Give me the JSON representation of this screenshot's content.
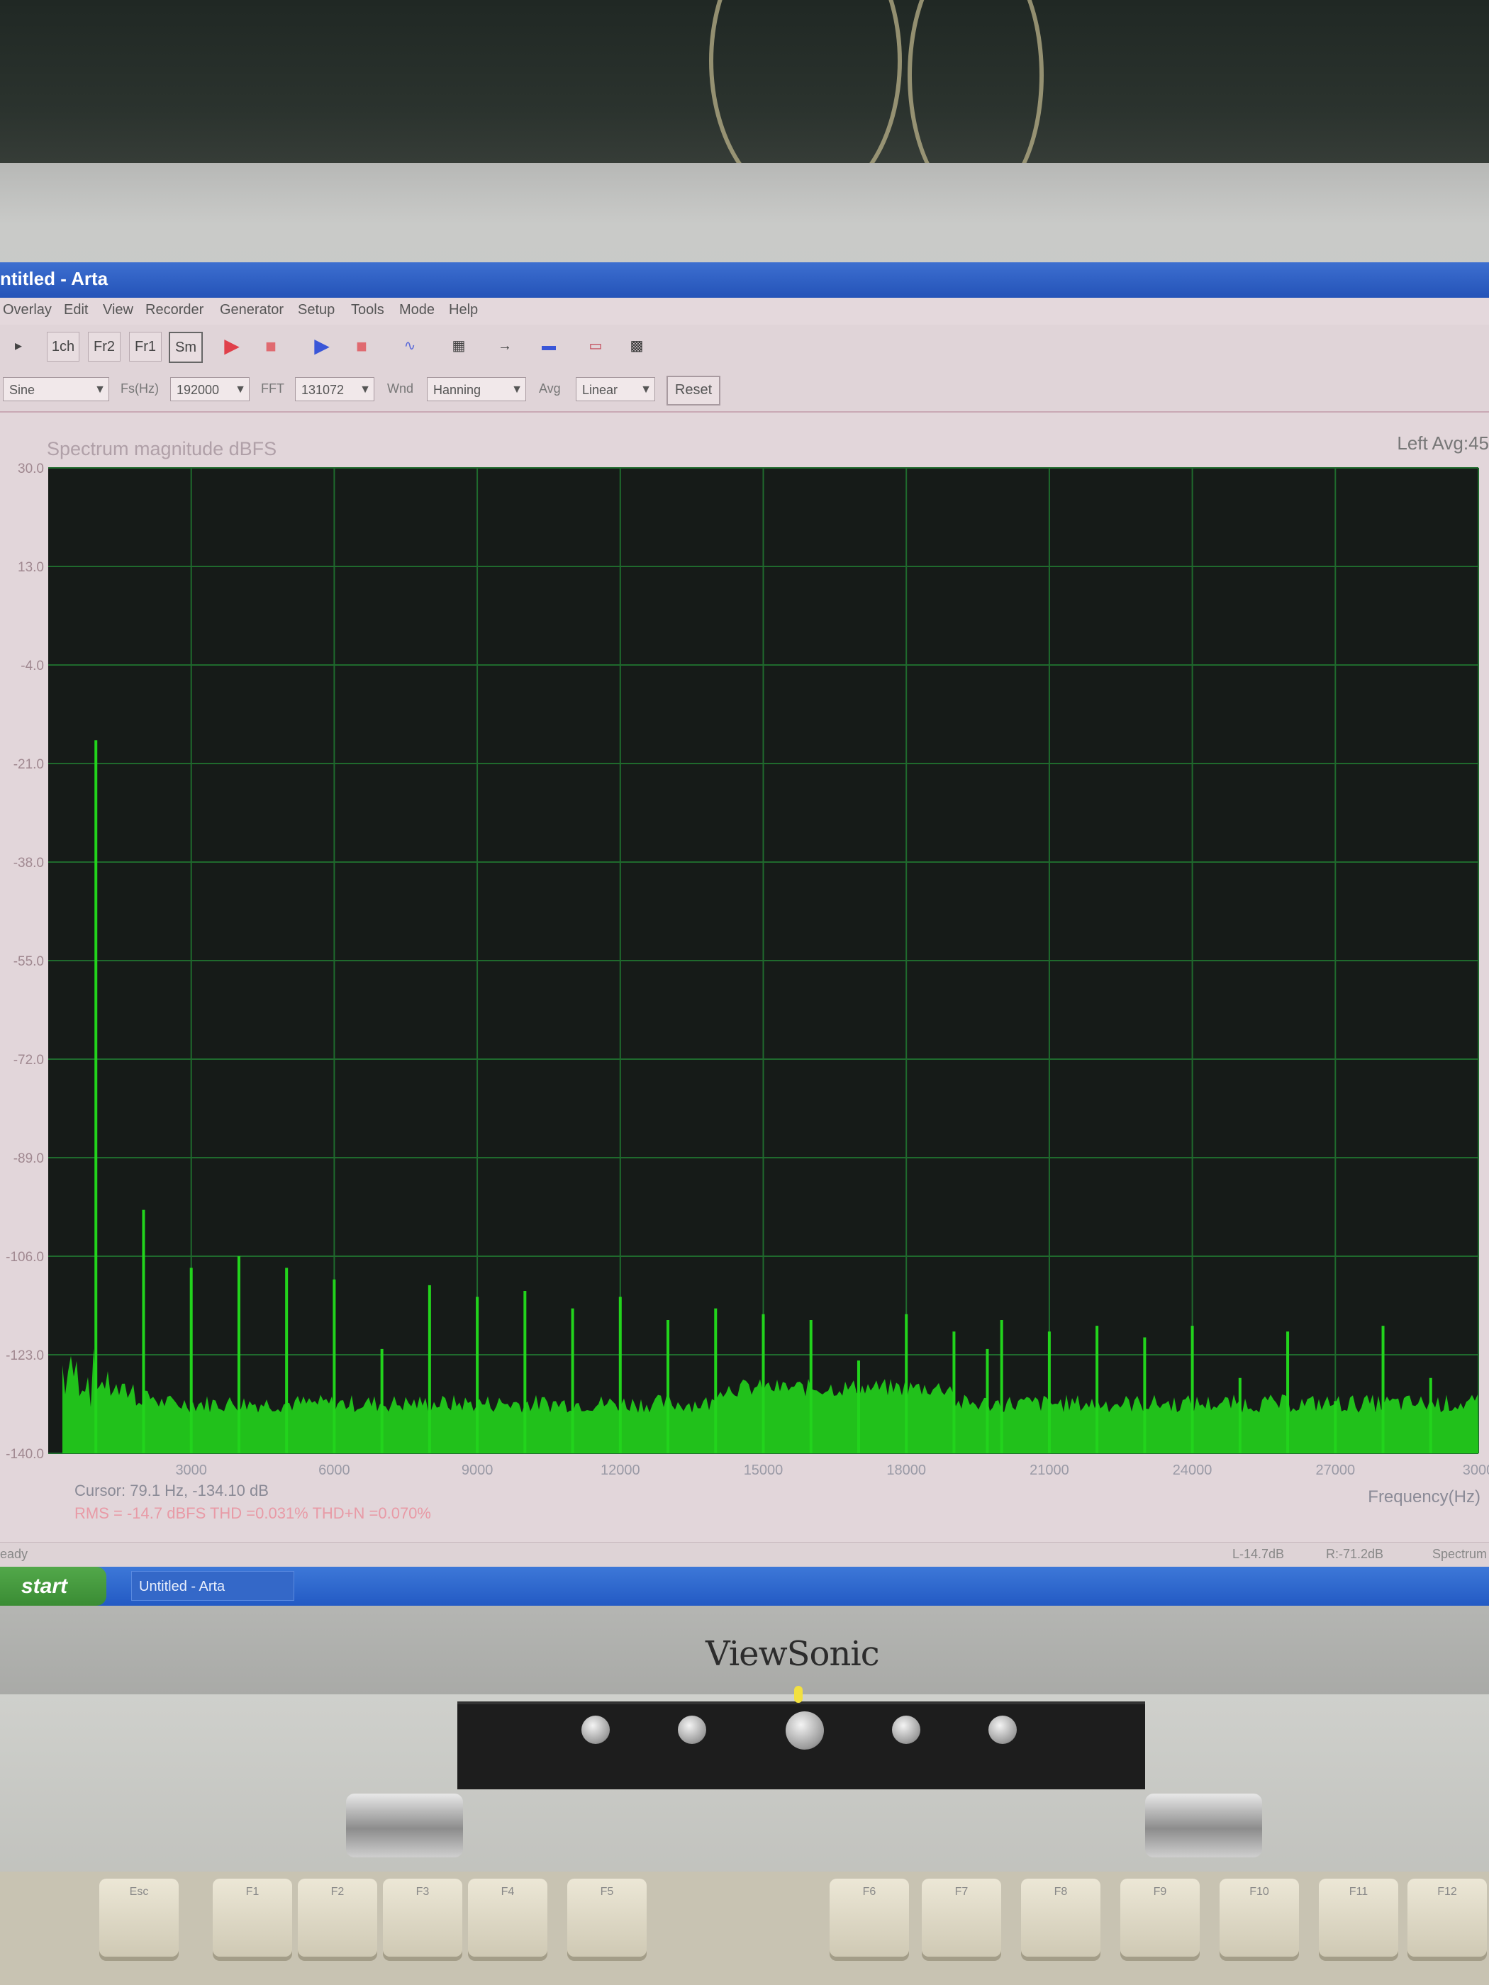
{
  "window": {
    "title": "ntitled - Arta",
    "menu": [
      "Overlay",
      "Edit",
      "View",
      "Recorder",
      "Generator",
      "Setup",
      "Tools",
      "Mode",
      "Help"
    ],
    "toolbar_buttons": [
      "1ch",
      "Fr2",
      "Fr1",
      "Sm"
    ]
  },
  "controls": {
    "signal": "Sine",
    "fs_label": "Fs(Hz)",
    "fs_value": "192000",
    "fft_label": "FFT",
    "fft_value": "131072",
    "wnd_label": "Wnd",
    "wnd_value": "Hanning",
    "avg_label": "Avg",
    "avg_value": "Linear",
    "reset_label": "Reset"
  },
  "chart_header": {
    "title": "Spectrum magnitude dBFS",
    "right": "Left  Avg:45"
  },
  "readouts": {
    "cursor": "Cursor:    79.1 Hz, -134.10 dB",
    "stats": "RMS = -14.7 dBFS    THD =0.031%    THD+N =0.070%",
    "freq_axis_label": "Frequency(Hz)"
  },
  "statusbar": {
    "left": "eady",
    "l_level": "L-14.7dB",
    "r_level": "R:-71.2dB",
    "mode": "Spectrum"
  },
  "taskbar": {
    "start": "start",
    "item": "Untitled - Arta"
  },
  "monitor": {
    "brand": "ViewSonic"
  },
  "keyboard": {
    "keys": [
      "Esc",
      "F1",
      "F2",
      "F3",
      "F4",
      "F5",
      "F6",
      "F7",
      "F8",
      "F9",
      "F10",
      "F11",
      "F12"
    ]
  },
  "colors": {
    "plot_bg": "#161b18",
    "grid": "#1f6a2d",
    "trace": "#22d41c"
  },
  "chart_data": {
    "type": "bar",
    "title": "Spectrum magnitude dBFS",
    "xlabel": "Frequency(Hz)",
    "ylabel": "",
    "xlim": [
      0,
      30000
    ],
    "ylim": [
      -140,
      30
    ],
    "x_ticks": [
      "3000",
      "6000",
      "9000",
      "12000",
      "15000",
      "18000",
      "21000",
      "24000",
      "27000",
      "3000"
    ],
    "y_ticks": [
      "30.0",
      "13.0",
      "-4.0",
      "-21.0",
      "-38.0",
      "-55.0",
      "-72.0",
      "-89.0",
      "-106.0",
      "-123.0",
      "-140.0"
    ],
    "peaks": [
      {
        "x": 1000,
        "y": -17
      },
      {
        "x": 2000,
        "y": -98
      },
      {
        "x": 3000,
        "y": -108
      },
      {
        "x": 4000,
        "y": -106
      },
      {
        "x": 5000,
        "y": -108
      },
      {
        "x": 6000,
        "y": -110
      },
      {
        "x": 7000,
        "y": -122
      },
      {
        "x": 8000,
        "y": -111
      },
      {
        "x": 9000,
        "y": -113
      },
      {
        "x": 10000,
        "y": -112
      },
      {
        "x": 11000,
        "y": -115
      },
      {
        "x": 12000,
        "y": -113
      },
      {
        "x": 13000,
        "y": -117
      },
      {
        "x": 14000,
        "y": -115
      },
      {
        "x": 15000,
        "y": -116
      },
      {
        "x": 16000,
        "y": -117
      },
      {
        "x": 17000,
        "y": -124
      },
      {
        "x": 18000,
        "y": -116
      },
      {
        "x": 19000,
        "y": -119
      },
      {
        "x": 19700,
        "y": -122
      },
      {
        "x": 20000,
        "y": -117
      },
      {
        "x": 21000,
        "y": -119
      },
      {
        "x": 22000,
        "y": -118
      },
      {
        "x": 23000,
        "y": -120
      },
      {
        "x": 24000,
        "y": -118
      },
      {
        "x": 25000,
        "y": -127
      },
      {
        "x": 26000,
        "y": -119
      },
      {
        "x": 27000,
        "y": -131
      },
      {
        "x": 28000,
        "y": -118
      },
      {
        "x": 29000,
        "y": -127
      }
    ],
    "noise_floor": -133
  }
}
